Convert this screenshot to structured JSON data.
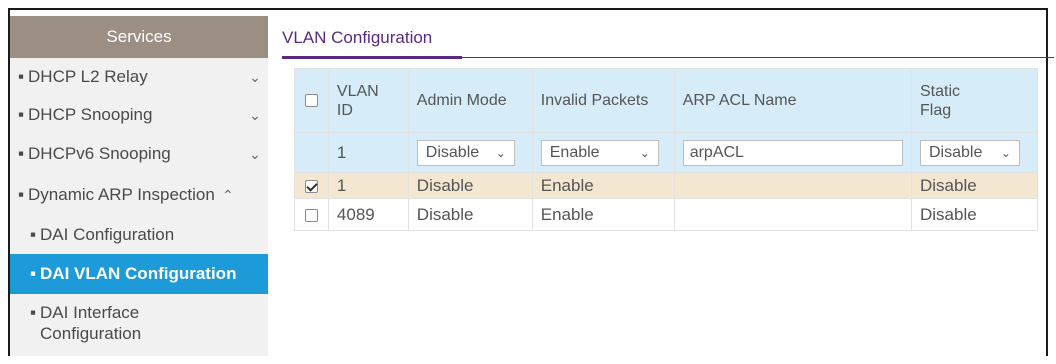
{
  "sidebar": {
    "header": "Services",
    "items": [
      {
        "label": "DHCP L2 Relay",
        "chevron": "⌄"
      },
      {
        "label": "DHCP Snooping",
        "chevron": "⌄"
      },
      {
        "label": "DHCPv6 Snooping",
        "chevron": "⌄"
      },
      {
        "label": "Dynamic ARP Inspection",
        "chevron": "⌃"
      }
    ],
    "subitems": [
      {
        "label": "DAI Configuration"
      },
      {
        "label": "DAI VLAN Configuration",
        "active": true
      },
      {
        "label_line1": "DAI Interface",
        "label_line2": "Configuration"
      }
    ]
  },
  "page": {
    "title": "VLAN Configuration"
  },
  "table": {
    "headers": {
      "vlan_line1": "VLAN",
      "vlan_line2": "ID",
      "admin_mode": "Admin Mode",
      "invalid_packets": "Invalid Packets",
      "arp_acl_name": "ARP ACL Name",
      "static_line1": "Static",
      "static_line2": "Flag"
    },
    "edit_row": {
      "vlan_id": "1",
      "admin_mode": "Disable",
      "invalid_packets": "Enable",
      "arp_acl_name": "arpACL",
      "static_flag": "Disable"
    },
    "rows": [
      {
        "checked": true,
        "vlan_id": "1",
        "admin_mode": "Disable",
        "invalid_packets": "Enable",
        "arp_acl_name": "",
        "static_flag": "Disable"
      },
      {
        "checked": false,
        "vlan_id": "4089",
        "admin_mode": "Disable",
        "invalid_packets": "Enable",
        "arp_acl_name": "",
        "static_flag": "Disable"
      }
    ]
  },
  "colors": {
    "accent_purple": "#5a2a82",
    "active_blue": "#1d9ad8",
    "header_tan": "#9b8f84",
    "table_header_blue": "#d6ecf8",
    "selected_row": "#f3e7d1"
  },
  "icons": {
    "chevron_down": "chevron-down-icon",
    "chevron_up": "chevron-up-icon",
    "select_arrow": "select-arrow-icon"
  }
}
